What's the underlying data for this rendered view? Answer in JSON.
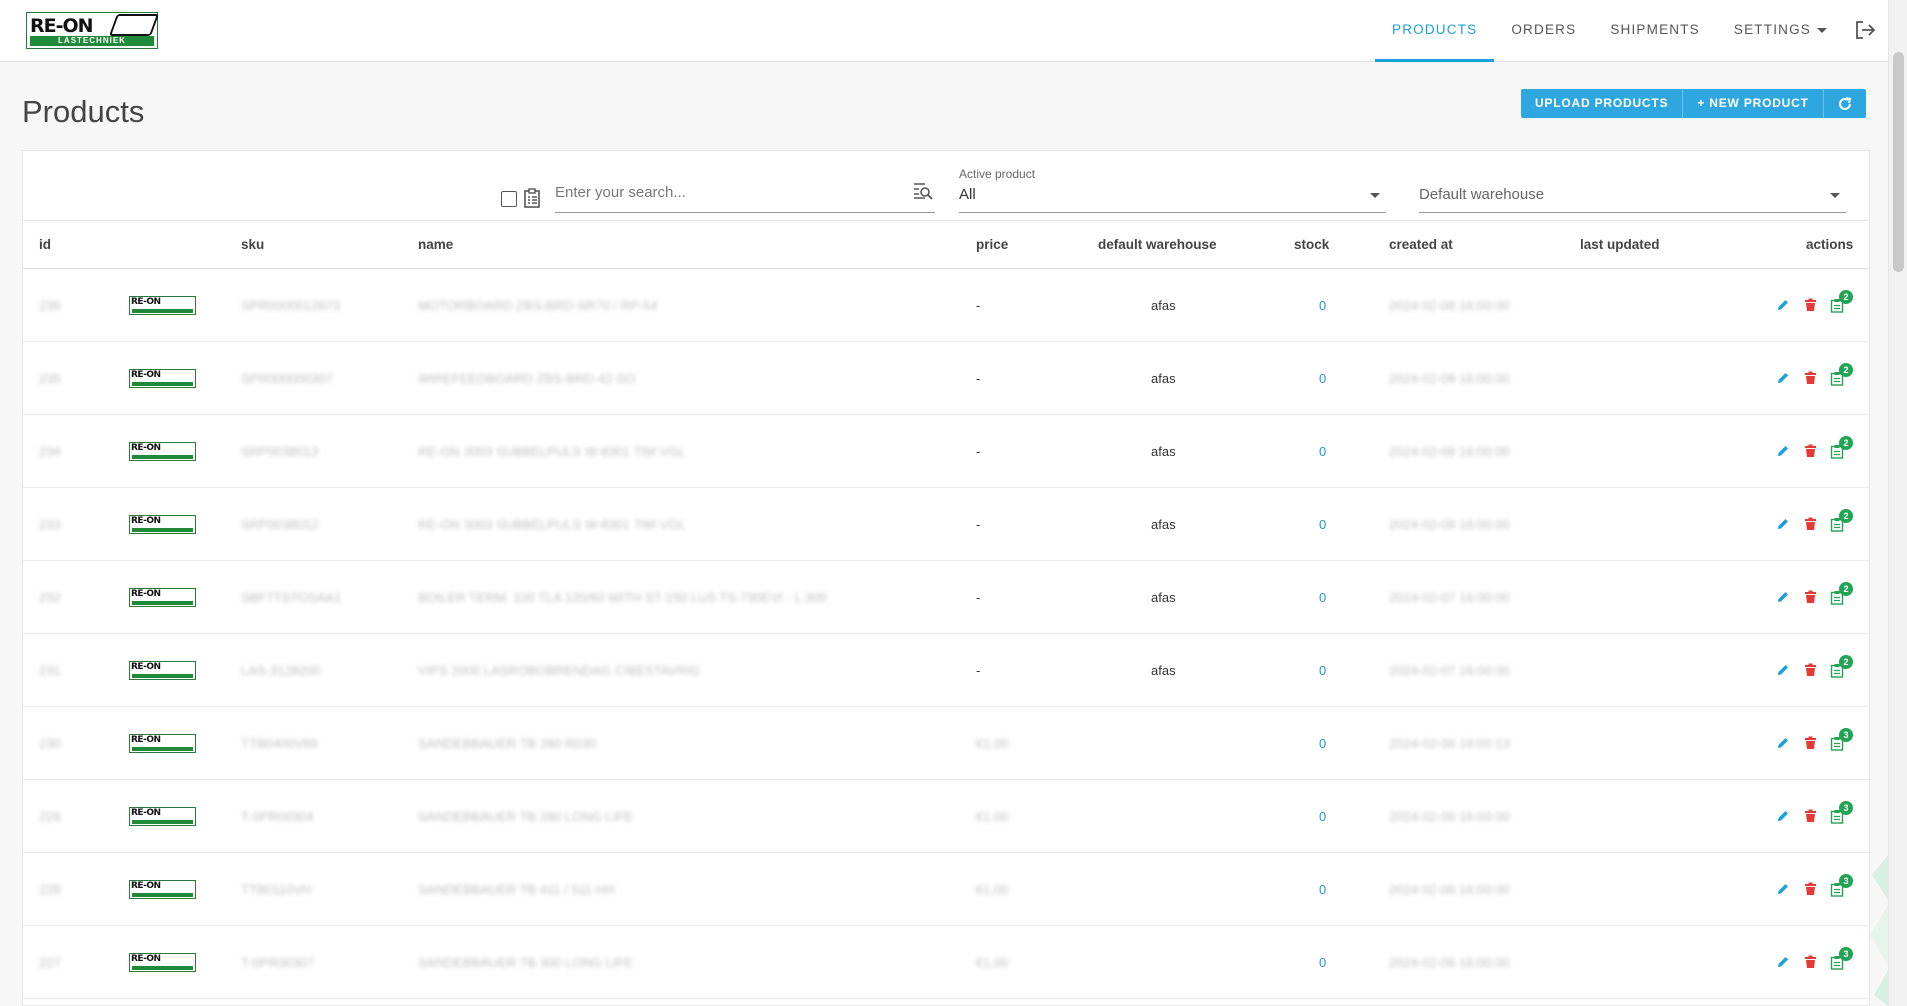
{
  "brand": {
    "logo_text": "RE-ON",
    "logo_sub": "LASTECHNIEK",
    "logo_icon": "laser-logo"
  },
  "nav": {
    "items": [
      {
        "label": "PRODUCTS",
        "active": true
      },
      {
        "label": "ORDERS",
        "active": false
      },
      {
        "label": "SHIPMENTS",
        "active": false
      },
      {
        "label": "SETTINGS",
        "active": false,
        "dropdown": true
      }
    ],
    "logout_icon": "logout-icon"
  },
  "page": {
    "title": "Products"
  },
  "toolbar": {
    "upload_label": "UPLOAD PRODUCTS",
    "new_label": "+ NEW PRODUCT",
    "refresh_icon": "refresh-icon"
  },
  "filters": {
    "search_placeholder": "Enter your search...",
    "active_product": {
      "label": "Active product",
      "value": "All"
    },
    "warehouse": {
      "placeholder": "Default warehouse"
    }
  },
  "colors": {
    "accent": "#1aa0dc",
    "edit": "#1aa0dc",
    "delete": "#e53935",
    "badge": "#22a454"
  },
  "table": {
    "columns": [
      "id",
      "sku",
      "name",
      "price",
      "default warehouse",
      "stock",
      "created at",
      "last updated",
      "actions"
    ],
    "rows": [
      {
        "id": "236",
        "sku": "SPR0000012673",
        "name": "MOTORBOARD ZBS-BRD-SR70 / RP-54",
        "price": "-",
        "warehouse": "afas",
        "stock": "0",
        "created": "2024-02-08 16:00:00",
        "updated": "",
        "badge": "2"
      },
      {
        "id": "235",
        "sku": "SPR000000307",
        "name": "WIREFEEDBOARD ZBS-BRD-42-SO",
        "price": "-",
        "warehouse": "afas",
        "stock": "0",
        "created": "2024-02-08 16:00:00",
        "updated": "",
        "badge": "2"
      },
      {
        "id": "234",
        "sku": "SRP0038013",
        "name": "RE-ON 3003 SUBBELPULS W-8301 TIM VGL",
        "price": "-",
        "warehouse": "afas",
        "stock": "0",
        "created": "2024-02-08 16:00:00",
        "updated": "",
        "badge": "2"
      },
      {
        "id": "233",
        "sku": "SRP0038012",
        "name": "RE-ON 3003 SUBBELPULS W-8301 TIM VGL",
        "price": "-",
        "warehouse": "afas",
        "stock": "0",
        "created": "2024-02-08 16:00:00",
        "updated": "",
        "badge": "2"
      },
      {
        "id": "232",
        "sku": "SBF7TSTOSAA1",
        "name": "BOILER TERM. 100 TLA 120/80 WITH ST-150 LUS TS-730EVI - L.300",
        "price": "-",
        "warehouse": "afas",
        "stock": "0",
        "created": "2024-02-07 16:00:00",
        "updated": "",
        "badge": "2"
      },
      {
        "id": "231",
        "sku": "LAS-3128200",
        "name": "VIPS 2000 LASROBOBRENDAG C/BESTAVRIG",
        "price": "-",
        "warehouse": "afas",
        "stock": "0",
        "created": "2024-02-07 16:00:00",
        "updated": "",
        "badge": "2"
      },
      {
        "id": "230",
        "sku": "TTB0400V89",
        "name": "SANDEBBAUER TB 260 R030",
        "price": "€1,00",
        "warehouse": "",
        "stock": "0",
        "created": "2024-02-06 16:00:13",
        "updated": "",
        "badge": "3"
      },
      {
        "id": "229",
        "sku": "T-0PR00304",
        "name": "SANDEBBAUER TB 260 LONG LIFE",
        "price": "€1,00",
        "warehouse": "",
        "stock": "0",
        "created": "2024-02-06 16:00:00",
        "updated": "",
        "badge": "3"
      },
      {
        "id": "228",
        "sku": "TTB0110VH",
        "name": "SANDEBBAUER TB 411 / 511 HH",
        "price": "€1,00",
        "warehouse": "",
        "stock": "0",
        "created": "2024-02-06 16:00:00",
        "updated": "",
        "badge": "3"
      },
      {
        "id": "227",
        "sku": "T-0PR00307",
        "name": "SANDEBBAUER TB 300 LONG LIFE",
        "price": "€1,00",
        "warehouse": "",
        "stock": "0",
        "created": "2024-02-06 16:00:00",
        "updated": "",
        "badge": "3"
      }
    ]
  }
}
